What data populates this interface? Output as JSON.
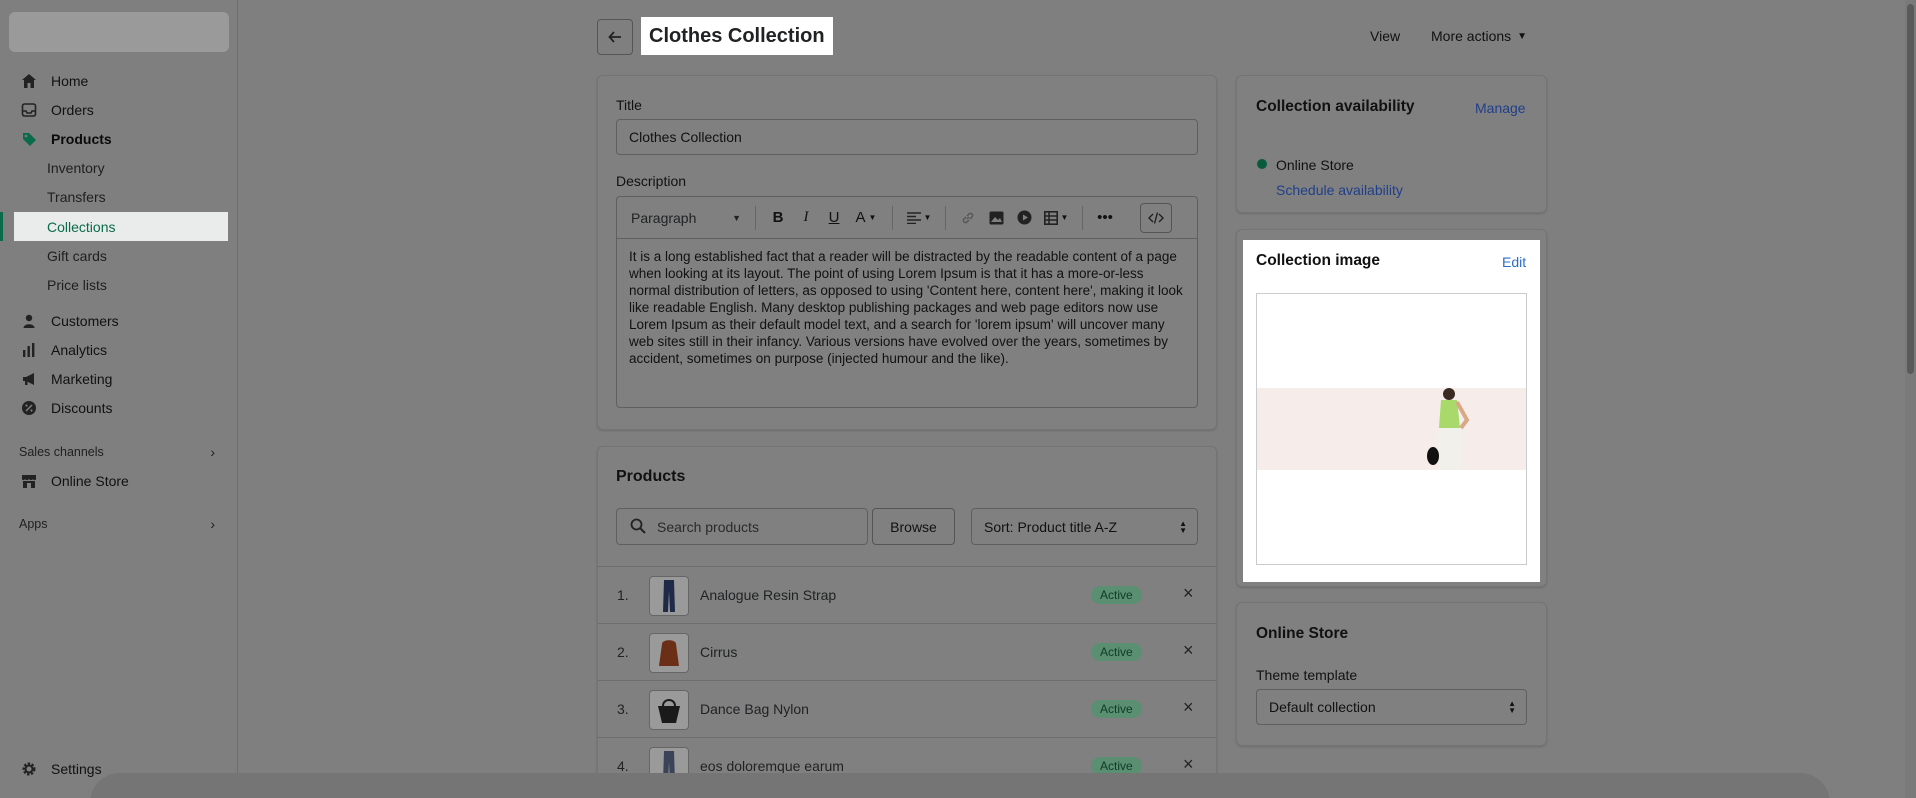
{
  "sidebar": {
    "items": [
      {
        "label": "Home",
        "icon": "home-icon"
      },
      {
        "label": "Orders",
        "icon": "orders-icon"
      },
      {
        "label": "Products",
        "icon": "tag-icon"
      }
    ],
    "product_sub": [
      "Inventory",
      "Transfers",
      "Collections",
      "Gift cards",
      "Price lists"
    ],
    "items2": [
      {
        "label": "Customers",
        "icon": "person-icon"
      },
      {
        "label": "Analytics",
        "icon": "bar-chart-icon"
      },
      {
        "label": "Marketing",
        "icon": "megaphone-icon"
      },
      {
        "label": "Discounts",
        "icon": "discount-icon"
      }
    ],
    "sales_channels_label": "Sales channels",
    "online_store_label": "Online Store",
    "apps_label": "Apps",
    "settings_label": "Settings",
    "accent_color": "#0a6b4a"
  },
  "header": {
    "title": "Clothes Collection",
    "view_label": "View",
    "more_actions_label": "More actions"
  },
  "details": {
    "title_label": "Title",
    "title_value": "Clothes Collection",
    "description_label": "Description",
    "paragraph_select": "Paragraph",
    "description_text": "It is a long established fact that a reader will be distracted by the readable content of a page when looking at its layout. The point of using Lorem Ipsum is that it has a more-or-less normal distribution of letters, as opposed to using 'Content here, content here', making it look like readable English. Many desktop publishing packages and web page editors now use Lorem Ipsum as their default model text, and a search for 'lorem ipsum' will uncover many web sites still in their infancy. Various versions have evolved over the years, sometimes by accident, sometimes on purpose (injected humour and the like)."
  },
  "products": {
    "heading": "Products",
    "search_placeholder": "Search products",
    "browse_label": "Browse",
    "sort_label": "Sort: Product title A-Z",
    "rows": [
      {
        "num": "1.",
        "name": "Analogue Resin Strap",
        "status": "Active"
      },
      {
        "num": "2.",
        "name": "Cirrus",
        "status": "Active"
      },
      {
        "num": "3.",
        "name": "Dance Bag Nylon",
        "status": "Active"
      },
      {
        "num": "4.",
        "name": "eos doloremque earum",
        "status": "Active"
      }
    ]
  },
  "availability": {
    "heading": "Collection availability",
    "manage_label": "Manage",
    "channel": "Online Store",
    "schedule_label": "Schedule availability"
  },
  "collection_image": {
    "heading": "Collection image",
    "edit_label": "Edit"
  },
  "online_store": {
    "heading": "Online Store",
    "theme_label": "Theme template",
    "theme_value": "Default collection"
  }
}
